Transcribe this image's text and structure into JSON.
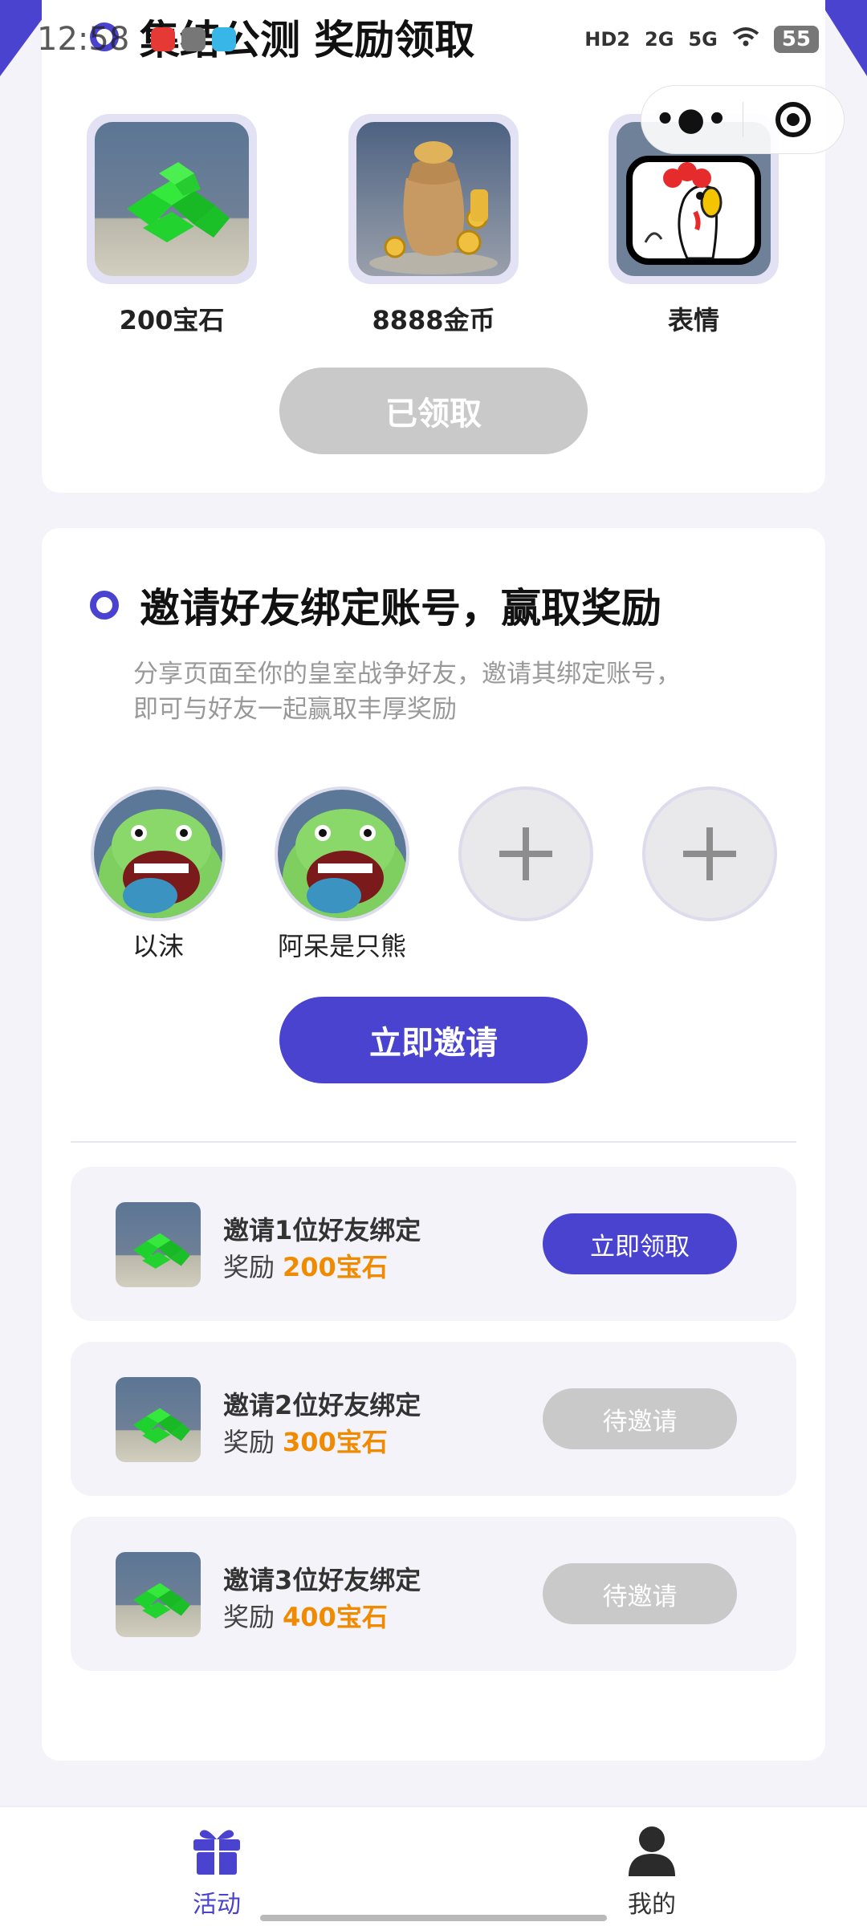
{
  "status_bar": {
    "time": "12:58",
    "network_labels": [
      "HD2",
      "2G",
      "5G"
    ],
    "battery": "55"
  },
  "header": {
    "title": "集结公测 奖励领取"
  },
  "rewards": [
    {
      "label": "200宝石",
      "icon": "gem-icon"
    },
    {
      "label": "8888金币",
      "icon": "coin-bag-icon"
    },
    {
      "label": "表情",
      "icon": "emote-icon"
    }
  ],
  "claim_button": "已领取",
  "invite": {
    "title": "邀请好友绑定账号，赢取奖励",
    "desc_line1": "分享页面至你的皇室战争好友，邀请其绑定账号，",
    "desc_line2": "即可与好友一起赢取丰厚奖励",
    "friends": [
      {
        "name": "以沫",
        "filled": true
      },
      {
        "name": "阿呆是只熊",
        "filled": true
      },
      {
        "name": "",
        "filled": false
      },
      {
        "name": "",
        "filled": false
      }
    ],
    "invite_button": "立即邀请"
  },
  "tasks": [
    {
      "title": "邀请1位好友绑定",
      "reward_prefix": "奖励",
      "reward_amount": "200宝石",
      "button": "立即领取",
      "state": "active"
    },
    {
      "title": "邀请2位好友绑定",
      "reward_prefix": "奖励",
      "reward_amount": "300宝石",
      "button": "待邀请",
      "state": "disabled"
    },
    {
      "title": "邀请3位好友绑定",
      "reward_prefix": "奖励",
      "reward_amount": "400宝石",
      "button": "待邀请",
      "state": "disabled"
    }
  ],
  "nav": [
    {
      "label": "活动",
      "icon": "gift-icon",
      "active": true
    },
    {
      "label": "我的",
      "icon": "user-icon",
      "active": false
    }
  ],
  "colors": {
    "accent": "#4a43cf",
    "reward_amount": "#f08a00",
    "disabled": "#c9c9c9",
    "page_bg": "#f3f3f9"
  }
}
